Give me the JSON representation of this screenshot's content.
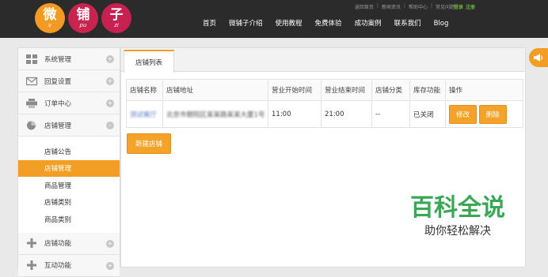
{
  "header": {
    "logo": [
      {
        "char": "微",
        "pinyin": "v"
      },
      {
        "char": "铺",
        "pinyin": "pu"
      },
      {
        "char": "子",
        "pinyin": "zi"
      }
    ],
    "top_links": [
      "返回首页",
      "新闻资讯",
      "帮助中心",
      "常见问题"
    ],
    "login": "登录",
    "register": "注册",
    "nav": [
      "首页",
      "微铺子介绍",
      "使用教程",
      "免费体验",
      "成功案例",
      "联系我们",
      "Blog"
    ]
  },
  "sidebar": {
    "groups_top": [
      {
        "label": "系统管理",
        "icon": "grid-icon",
        "toggle": "+"
      },
      {
        "label": "回复设置",
        "icon": "mail-icon",
        "toggle": "+"
      },
      {
        "label": "订单中心",
        "icon": "printer-icon",
        "toggle": "+"
      },
      {
        "label": "店铺管理",
        "icon": "pie-chart-icon",
        "toggle": "-"
      }
    ],
    "sub_items": [
      "店铺公告",
      "店铺管理",
      "商品管理",
      "店铺类别",
      "商品类别"
    ],
    "groups_bottom": [
      {
        "label": "店铺功能",
        "icon": "plus-icon",
        "toggle": "+"
      },
      {
        "label": "互动功能",
        "icon": "plus-icon",
        "toggle": "+"
      }
    ]
  },
  "main": {
    "tab": "店铺列表",
    "columns": [
      "店铺名称",
      "店铺地址",
      "营业开始时间",
      "营业结束时间",
      "店铺分类",
      "库存功能",
      "操作"
    ],
    "rows": [
      {
        "name": "测试餐厅",
        "address": "北京市朝阳区某某路某某大厦1号",
        "start": "11:00",
        "end": "21:00",
        "category": "--",
        "stock": "已关闭",
        "edit": "修改",
        "delete": "删除"
      }
    ],
    "new_button": "新建店铺"
  },
  "watermark": {
    "title": "百科全说",
    "subtitle": "助你轻松解决"
  },
  "colors": {
    "accent": "#f29d24",
    "header_bg": "#2b2b2b",
    "watermark_green": "#3aa656"
  }
}
